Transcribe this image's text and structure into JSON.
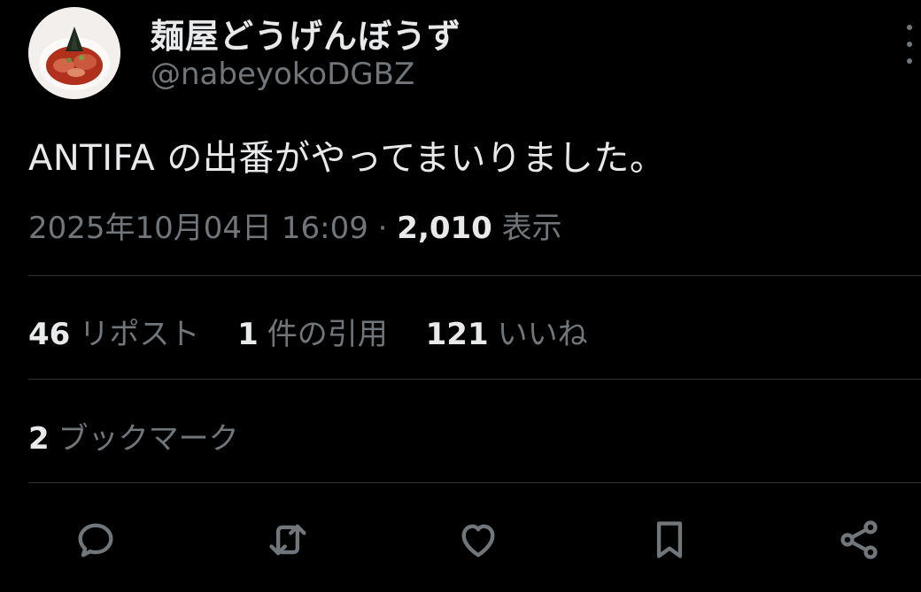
{
  "user": {
    "display_name": "麺屋どうげんぼうず",
    "handle": "@nabeyokoDGBZ"
  },
  "tweet": {
    "text": "ANTIFA の出番がやってまいりました。",
    "timestamp": "2025年10月04日 16:09",
    "separator": "·",
    "views_count": "2,010",
    "views_label": "表示"
  },
  "stats": {
    "reposts_count": "46",
    "reposts_label": "リポスト",
    "quotes_count": "1",
    "quotes_label": "件の引用",
    "likes_count": "121",
    "likes_label": "いいね",
    "bookmarks_count": "2",
    "bookmarks_label": "ブックマーク"
  },
  "actions": [
    "reply-icon",
    "retweet-icon",
    "heart-icon",
    "bookmark-icon",
    "share-icon"
  ],
  "colors": {
    "background": "#000000",
    "primary_text": "#e7e9ea",
    "secondary_text": "#71767b",
    "divider": "#2f3336"
  }
}
